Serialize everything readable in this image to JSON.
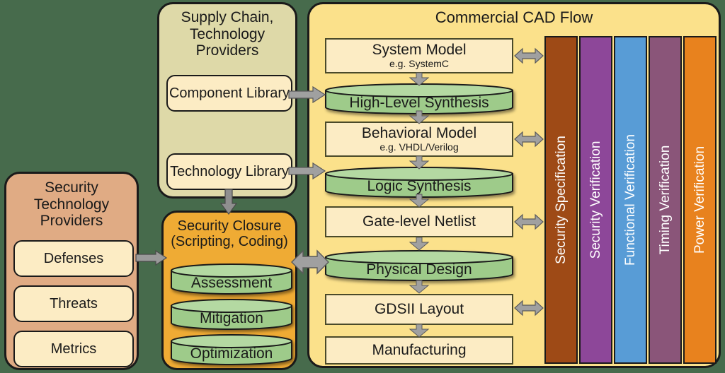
{
  "colors": {
    "background": "#476b4c",
    "supply_chain_panel": "#ded9a8",
    "security_tech_panel": "#e0ab84",
    "security_closure_panel": "#efab34",
    "cad_flow_panel": "#fbe18b",
    "box_fill": "#fcecc4",
    "cylinder_fill": "#9ecb8a",
    "arrow_gray": "#a0a0a0",
    "outline": "#1a1a1a",
    "bar_security_specification": "#9e4a16",
    "bar_security_verification": "#8d4799",
    "bar_functional_verification": "#589cd6",
    "bar_timing_verification": "#8a5579",
    "bar_power_verification": "#e8821e"
  },
  "supply_chain": {
    "title": "Supply Chain,\nTechnology\nProviders",
    "items": [
      {
        "label": "Component Library"
      },
      {
        "label": "Technology Library"
      }
    ]
  },
  "security_tech_providers": {
    "title": "Security\nTechnology\nProviders",
    "items": [
      {
        "label": "Defenses"
      },
      {
        "label": "Threats"
      },
      {
        "label": "Metrics"
      }
    ]
  },
  "security_closure": {
    "title": "Security Closure\n(Scripting, Coding)",
    "items": [
      {
        "label": "Assessment"
      },
      {
        "label": "Mitigation"
      },
      {
        "label": "Optimization"
      }
    ]
  },
  "cad_flow": {
    "title": "Commercial CAD Flow",
    "steps": [
      {
        "kind": "box",
        "label": "System Model",
        "sub": "e.g. SystemC"
      },
      {
        "kind": "cylinder",
        "label": "High-Level Synthesis",
        "sub": ""
      },
      {
        "kind": "box",
        "label": "Behavioral Model",
        "sub": "e.g. VHDL/Verilog"
      },
      {
        "kind": "cylinder",
        "label": "Logic Synthesis",
        "sub": ""
      },
      {
        "kind": "box",
        "label": "Gate-level Netlist",
        "sub": ""
      },
      {
        "kind": "cylinder",
        "label": "Physical Design",
        "sub": ""
      },
      {
        "kind": "box",
        "label": "GDSII Layout",
        "sub": ""
      },
      {
        "kind": "box",
        "label": "Manufacturing",
        "sub": ""
      }
    ],
    "verification_bars": [
      {
        "label": "Security Specification",
        "color": "#9e4a16"
      },
      {
        "label": "Security Verification",
        "color": "#8d4799"
      },
      {
        "label": "Functional Verification",
        "color": "#589cd6"
      },
      {
        "label": "Timing Verification",
        "color": "#8a5579"
      },
      {
        "label": "Power Verification",
        "color": "#e8821e"
      }
    ]
  }
}
